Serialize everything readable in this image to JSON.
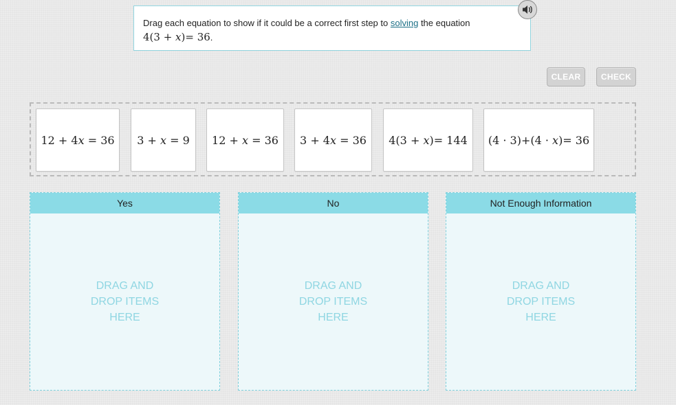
{
  "prompt": {
    "before_link": "Drag each equation to show if it could be a correct first step to ",
    "link": "solving",
    "after_link": " the equation",
    "equation": {
      "a": "4(3 + ",
      "var": "x",
      "b": ")= 36"
    },
    "period": "."
  },
  "audio": {
    "icon": "speaker-icon"
  },
  "buttons": {
    "clear": "CLEAR",
    "check": "CHECK"
  },
  "items": [
    {
      "a": "12 + 4",
      "var": "x",
      "b": " = 36"
    },
    {
      "a": "3 + ",
      "var": "x",
      "b": " = 9"
    },
    {
      "a": "12 + ",
      "var": "x",
      "b": " = 36"
    },
    {
      "a": "3 + 4",
      "var": "x",
      "b": " = 36"
    },
    {
      "a": "4(3 + ",
      "var": "x",
      "b": ")= 144"
    },
    {
      "a": "(4 · 3)+(4 · ",
      "var": "x",
      "b": ")= 36"
    }
  ],
  "zones": [
    {
      "title": "Yes",
      "hint": "DRAG AND DROP ITEMS HERE"
    },
    {
      "title": "No",
      "hint": "DRAG AND DROP ITEMS HERE"
    },
    {
      "title": "Not Enough Information",
      "hint": "DRAG AND DROP ITEMS HERE"
    }
  ],
  "colors": {
    "accent": "#8bdbe6",
    "zone_bg": "#edf8fa",
    "link": "#1b6f86",
    "button_bg": "#d3d3d3"
  }
}
